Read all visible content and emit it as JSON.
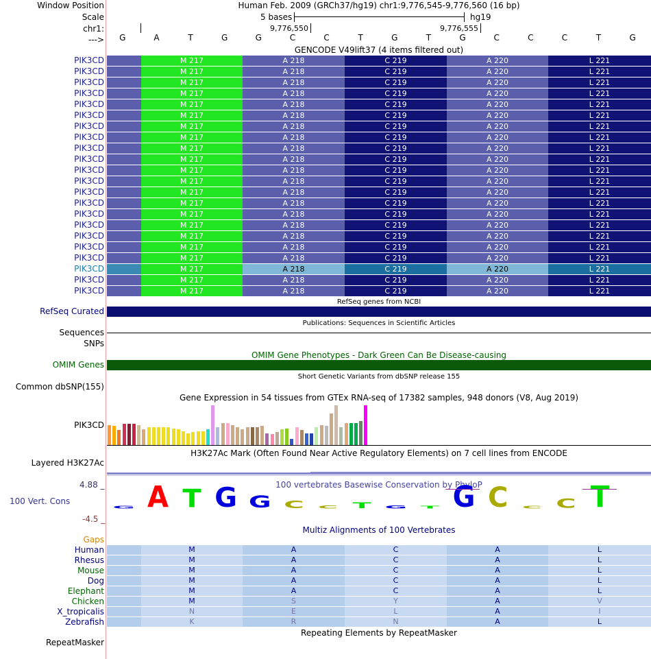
{
  "header": {
    "window_position_label": "Window Position",
    "scale_label": "Scale",
    "chr_label": "chr1:",
    "arrow_label": "--->",
    "assembly_text": "Human Feb. 2009 (GRCh37/hg19)   chr1:9,776,545-9,776,560 (16 bp)",
    "scale_text": "5 bases",
    "scale_db": "hg19",
    "pos_left": "9,776,550",
    "pos_right": "9,776,555",
    "bases": [
      "G",
      "A",
      "T",
      "G",
      "G",
      "C",
      "C",
      "T",
      "G",
      "T",
      "G",
      "C",
      "C",
      "C",
      "T",
      "G"
    ]
  },
  "gencode": {
    "title": "GENCODE V49lift37 (4 items filtered out)",
    "gene_label": "PIK3CD",
    "highlight_row_index": 19,
    "row_count": 22,
    "codons": [
      {
        "label": "",
        "color": "#5b5eab"
      },
      {
        "label": "M 217",
        "color": "#22e622"
      },
      {
        "label": "A 218",
        "color": "#5b5eab"
      },
      {
        "label": "C 219",
        "color": "#101274"
      },
      {
        "label": "A 220",
        "color": "#5b5eab"
      },
      {
        "label": "L 221",
        "color": "#101274"
      }
    ],
    "highlight_colors": [
      "#3a8ab4",
      "#22e622",
      "#7fb8d6",
      "#1a6fa0",
      "#7fb8d6",
      "#1a6fa0"
    ]
  },
  "refseq": {
    "title": "RefSeq genes from NCBI",
    "label": "RefSeq Curated",
    "color": "#0c0f70"
  },
  "publications": {
    "title": "Publications: Sequences in Scientific Articles",
    "label_sequences": "Sequences",
    "label_snps": "SNPs"
  },
  "omim": {
    "title": "OMIM Gene Phenotypes - Dark Green Can Be Disease-causing",
    "label": "OMIM Genes",
    "color": "#0a5a0a"
  },
  "dbsnp": {
    "title": "Short Genetic Variants from dbSNP release 155",
    "label": "Common dbSNP(155)"
  },
  "gtex": {
    "title": "Gene Expression in 54 tissues from GTEx RNA-seq of 17382 samples, 948 donors (V8, Aug 2019)",
    "label": "PIK3CD",
    "bars": [
      {
        "v": 0.5,
        "c": "#ff9933"
      },
      {
        "v": 0.48,
        "c": "#ffaa00"
      },
      {
        "v": 0.38,
        "c": "#ee7a22"
      },
      {
        "v": 0.53,
        "c": "#cc3355"
      },
      {
        "v": 0.53,
        "c": "#7a2233"
      },
      {
        "v": 0.53,
        "c": "#cc2244"
      },
      {
        "v": 0.5,
        "c": "#ccbb99"
      },
      {
        "v": 0.4,
        "c": "#ddaa77"
      },
      {
        "v": 0.45,
        "c": "#eedd22"
      },
      {
        "v": 0.45,
        "c": "#eedd22"
      },
      {
        "v": 0.45,
        "c": "#eedd22"
      },
      {
        "v": 0.45,
        "c": "#eedd22"
      },
      {
        "v": 0.45,
        "c": "#eedd22"
      },
      {
        "v": 0.42,
        "c": "#eedd22"
      },
      {
        "v": 0.4,
        "c": "#eedd22"
      },
      {
        "v": 0.35,
        "c": "#eedd22"
      },
      {
        "v": 0.3,
        "c": "#eedd22"
      },
      {
        "v": 0.32,
        "c": "#eedd22"
      },
      {
        "v": 0.35,
        "c": "#eedd22"
      },
      {
        "v": 0.35,
        "c": "#eedd22"
      },
      {
        "v": 0.4,
        "c": "#22ddcc"
      },
      {
        "v": 1.0,
        "c": "#dd99ee"
      },
      {
        "v": 0.45,
        "c": "#aabbdd"
      },
      {
        "v": 0.55,
        "c": "#ccaa88"
      },
      {
        "v": 0.55,
        "c": "#ffaacc"
      },
      {
        "v": 0.5,
        "c": "#ccaa88"
      },
      {
        "v": 0.45,
        "c": "#ccaa88"
      },
      {
        "v": 0.4,
        "c": "#ccaa88"
      },
      {
        "v": 0.45,
        "c": "#ccaa88"
      },
      {
        "v": 0.45,
        "c": "#886644"
      },
      {
        "v": 0.45,
        "c": "#aa8866"
      },
      {
        "v": 0.48,
        "c": "#ccaa88"
      },
      {
        "v": 0.3,
        "c": "#aa66aa"
      },
      {
        "v": 0.28,
        "c": "#ff88aa"
      },
      {
        "v": 0.32,
        "c": "#bbaa99"
      },
      {
        "v": 0.4,
        "c": "#aadd44"
      },
      {
        "v": 0.42,
        "c": "#88cc22"
      },
      {
        "v": 0.15,
        "c": "#3355cc"
      },
      {
        "v": 0.45,
        "c": "#ffaacc"
      },
      {
        "v": 0.38,
        "c": "#aa8866"
      },
      {
        "v": 0.3,
        "c": "#3366cc"
      },
      {
        "v": 0.3,
        "c": "#2244aa"
      },
      {
        "v": 0.45,
        "c": "#bbeeaa"
      },
      {
        "v": 0.5,
        "c": "#ccaa88"
      },
      {
        "v": 0.48,
        "c": "#bbbbbb"
      },
      {
        "v": 0.8,
        "c": "#ccaa88"
      },
      {
        "v": 1.0,
        "c": "#ccbbaa"
      },
      {
        "v": 0.45,
        "c": "#aabbaa"
      },
      {
        "v": 0.55,
        "c": "#ddaa77"
      },
      {
        "v": 0.55,
        "c": "#00aa44"
      },
      {
        "v": 0.55,
        "c": "#00aa55"
      },
      {
        "v": 0.6,
        "c": "#668866"
      },
      {
        "v": 1.0,
        "c": "#ff00ff"
      }
    ]
  },
  "h3k27ac": {
    "title": "H3K27Ac Mark (Often Found Near Active Regulatory Elements) on 7 cell lines from ENCODE",
    "label": "Layered H3K27Ac"
  },
  "conservation": {
    "title": "100 vertebrates Basewise Conservation by PhyloP",
    "label": "100 Vert. Cons",
    "ymax": "4.88 _",
    "ymin": "-4.5 _",
    "logo": [
      {
        "ch": "G",
        "h": 0.12,
        "c": "#0000dd"
      },
      {
        "ch": "A",
        "h": 1.0,
        "c": "#ff0000"
      },
      {
        "ch": "T",
        "h": 0.85,
        "c": "#00dd00"
      },
      {
        "ch": "G",
        "h": 0.9,
        "c": "#0000dd"
      },
      {
        "ch": "G",
        "h": 0.55,
        "c": "#0000dd"
      },
      {
        "ch": "C",
        "h": 0.35,
        "c": "#aaaa00"
      },
      {
        "ch": "C",
        "h": 0.15,
        "c": "#aaaa00"
      },
      {
        "ch": "T",
        "h": 0.25,
        "c": "#00dd00"
      },
      {
        "ch": "G",
        "h": 0.15,
        "c": "#0000dd"
      },
      {
        "ch": "T",
        "h": 0.1,
        "c": "#00dd00"
      },
      {
        "ch": "G",
        "h": 1.0,
        "c": "#0000dd"
      },
      {
        "ch": "C",
        "h": 0.95,
        "c": "#aaaa00"
      },
      {
        "ch": "C",
        "h": 0.08,
        "c": "#aaaa00"
      },
      {
        "ch": "C",
        "h": 0.45,
        "c": "#aaaa00"
      },
      {
        "ch": "T",
        "h": 1.0,
        "c": "#00dd00"
      }
    ]
  },
  "multiz": {
    "title": "Multiz Alignments of 100 Vertebrates",
    "gaps_label": "Gaps",
    "species": [
      {
        "name": "Human",
        "color": "#000080",
        "aa": [
          "M",
          "A",
          "C",
          "A",
          "L"
        ],
        "dim": [
          false,
          false,
          false,
          false,
          false
        ]
      },
      {
        "name": "Rhesus",
        "color": "#000080",
        "aa": [
          "M",
          "A",
          "C",
          "A",
          "L"
        ],
        "dim": [
          false,
          false,
          false,
          false,
          false
        ]
      },
      {
        "name": "Mouse",
        "color": "#006400",
        "aa": [
          "M",
          "A",
          "C",
          "A",
          "L"
        ],
        "dim": [
          false,
          false,
          false,
          false,
          false
        ]
      },
      {
        "name": "Dog",
        "color": "#000080",
        "aa": [
          "M",
          "A",
          "C",
          "A",
          "L"
        ],
        "dim": [
          false,
          false,
          false,
          false,
          false
        ]
      },
      {
        "name": "Elephant",
        "color": "#006400",
        "aa": [
          "M",
          "A",
          "C",
          "A",
          "L"
        ],
        "dim": [
          false,
          false,
          false,
          false,
          false
        ]
      },
      {
        "name": "Chicken",
        "color": "#006400",
        "aa": [
          "M",
          "S",
          "Y",
          "A",
          "V"
        ],
        "dim": [
          false,
          true,
          true,
          false,
          true
        ]
      },
      {
        "name": "X_tropicalis",
        "color": "#000080",
        "aa": [
          "N",
          "E",
          "L",
          "A",
          "I"
        ],
        "dim": [
          true,
          true,
          true,
          false,
          true
        ]
      },
      {
        "name": "Zebrafish",
        "color": "#000080",
        "aa": [
          "K",
          "R",
          "N",
          "A",
          "L"
        ],
        "dim": [
          true,
          true,
          true,
          false,
          false
        ]
      }
    ]
  },
  "repeatmasker": {
    "title": "Repeating Elements by RepeatMasker",
    "label": "RepeatMasker"
  }
}
